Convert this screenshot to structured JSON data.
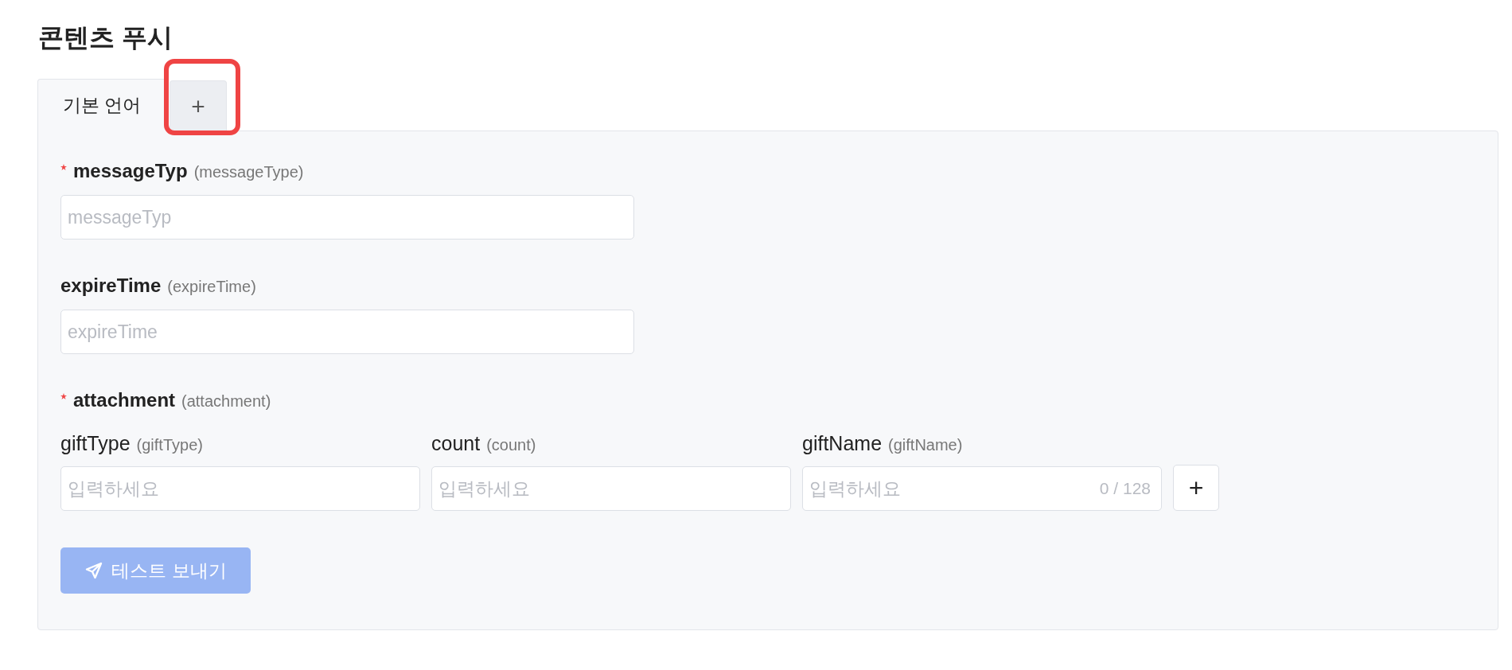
{
  "title": "콘텐츠 푸시",
  "tabs": [
    {
      "kind": "text",
      "label": "기본 언어",
      "selected": true,
      "highlighted": false
    },
    {
      "kind": "add",
      "label": "+",
      "selected": false,
      "highlighted": true
    }
  ],
  "fields": [
    {
      "required": true,
      "label": "messageTyp",
      "key": "(messageType)",
      "placeholder": "messageTyp"
    },
    {
      "required": false,
      "label": "expireTime",
      "key": "(expireTime)",
      "placeholder": "expireTime"
    }
  ],
  "attachment": {
    "required": true,
    "label": "attachment",
    "key": "(attachment)",
    "columns": [
      {
        "label": "giftType",
        "key": "(giftType)",
        "placeholder": "입력하세요"
      },
      {
        "label": "count",
        "key": "(count)",
        "placeholder": "입력하세요"
      },
      {
        "label": "giftName",
        "key": "(giftName)",
        "placeholder": "입력하세요",
        "counter": "0 / 128"
      }
    ],
    "add_button": "+"
  },
  "send_button": {
    "label": "테스트 보내기",
    "disabled": true
  }
}
